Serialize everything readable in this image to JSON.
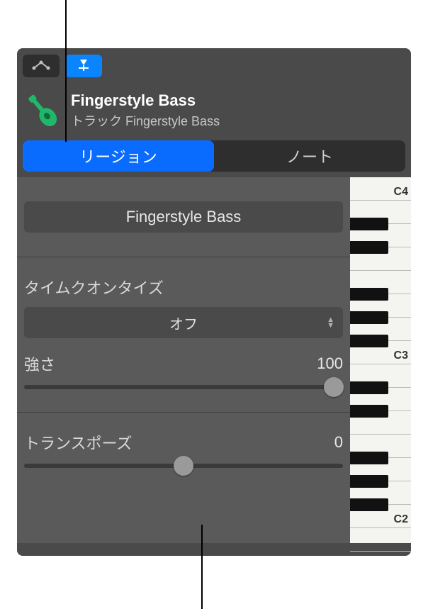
{
  "header": {
    "title": "Fingerstyle Bass",
    "subtitle_prefix": "トラック",
    "subtitle_name": "Fingerstyle Bass"
  },
  "tabs": {
    "region": "リージョン",
    "note": "ノート"
  },
  "region_name": "Fingerstyle Bass",
  "quantize": {
    "label": "タイムクオンタイズ",
    "value": "オフ"
  },
  "strength": {
    "label": "強さ",
    "value": "100",
    "percent": 100
  },
  "transpose": {
    "label": "トランスポーズ",
    "value": "0",
    "percent": 50
  },
  "piano_labels": {
    "c4": "C4",
    "c3": "C3",
    "c2": "C2"
  }
}
